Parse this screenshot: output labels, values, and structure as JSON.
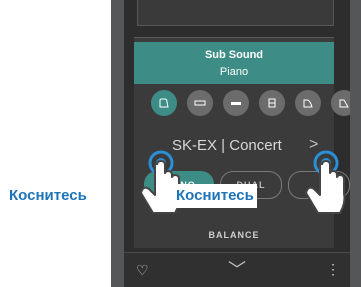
{
  "panel": {
    "header_title": "Sub Sound",
    "header_subtitle": "Piano",
    "current_sound": "SK-EX | Concert",
    "next_glyph": ">",
    "modes": [
      "PIANO",
      "DUAL",
      ""
    ],
    "balance_label": "BALANCE"
  },
  "category_icons": [
    "grand-piano-icon",
    "electric-piano-icon",
    "organ-icon",
    "harpsichord-icon",
    "strings-icon",
    "more-icon"
  ],
  "bottombar": {
    "favorite_glyph": "♡",
    "collapse_glyph": "﹀",
    "menu_glyph": "⋮"
  },
  "callouts": {
    "left": "Коснитесь",
    "right": "Коснитесь"
  },
  "colors": {
    "accent": "#3d8d86",
    "callout_text": "#1e74b8"
  }
}
